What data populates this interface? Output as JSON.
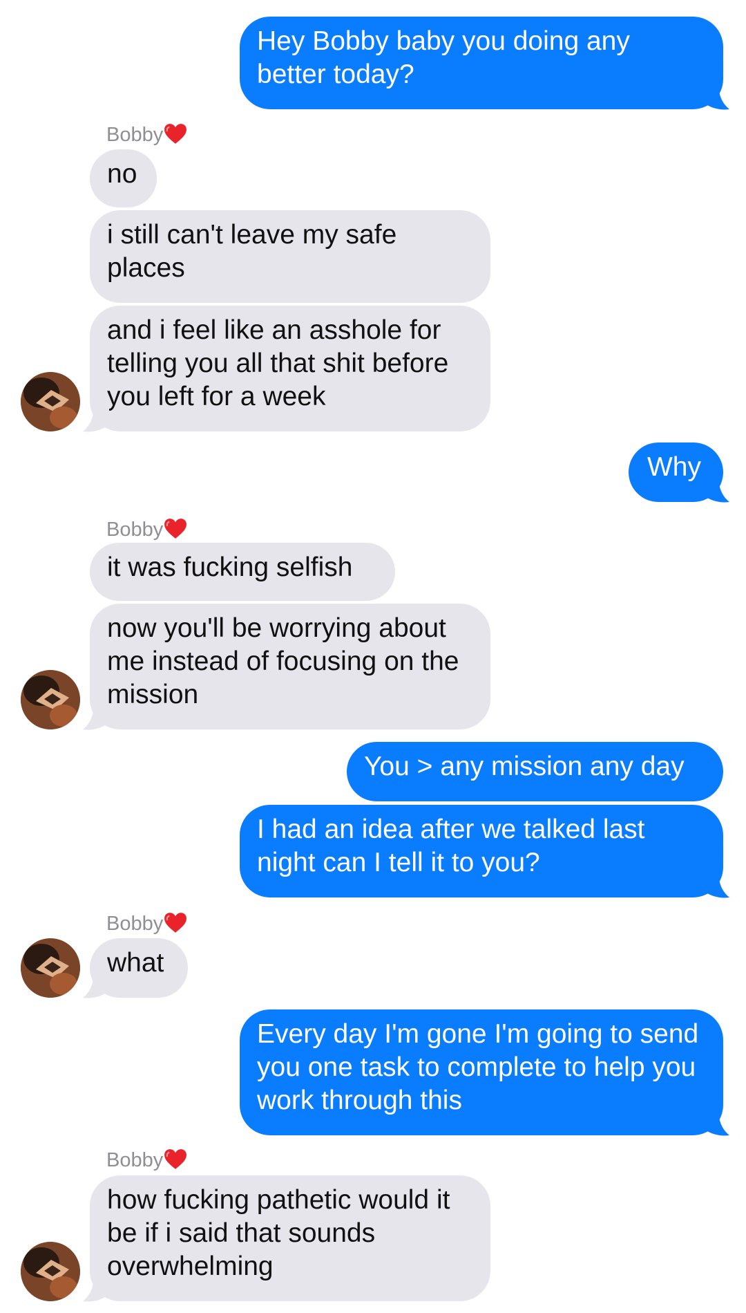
{
  "conversation": {
    "contact_name": "Bobby",
    "colors": {
      "sent_bubble": "#0a7cfe",
      "received_bubble": "#e6e5eb",
      "sender_name": "#8e8e93"
    },
    "messages": [
      {
        "from": "me",
        "text": "Hey Bobby baby you doing any better today?"
      },
      {
        "from": "Bobby",
        "text": "no"
      },
      {
        "from": "Bobby",
        "text": "i still can't leave my safe places"
      },
      {
        "from": "Bobby",
        "text": "and i feel like an asshole for telling you all that shit before you left for a week"
      },
      {
        "from": "me",
        "text": "Why"
      },
      {
        "from": "Bobby",
        "text": "it was fucking selfish"
      },
      {
        "from": "Bobby",
        "text": "now you'll be worrying about me instead of focusing on the mission"
      },
      {
        "from": "me",
        "text": "You > any mission any day"
      },
      {
        "from": "me",
        "text": "I had an idea after we talked last night can I tell it to you?"
      },
      {
        "from": "Bobby",
        "text": "what"
      },
      {
        "from": "me",
        "text": "Every day I'm gone I'm going to send you one task to complete to help you work through this"
      },
      {
        "from": "Bobby",
        "text": "how fucking pathetic would it be if i said that sounds overwhelming"
      }
    ]
  }
}
